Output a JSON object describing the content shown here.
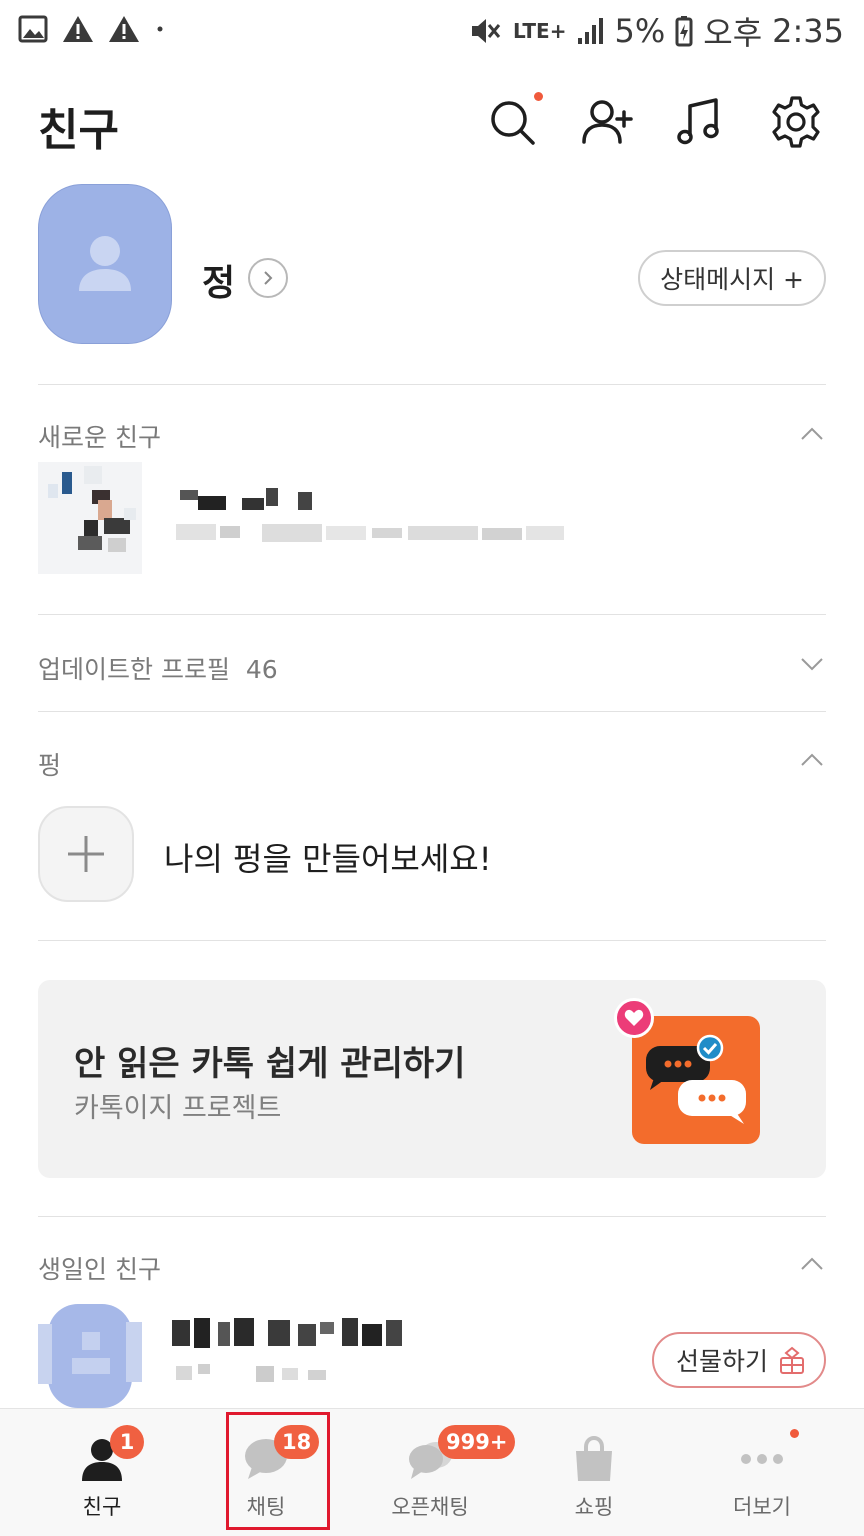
{
  "status_bar": {
    "battery": "5%",
    "network": "LTE+",
    "time_period": "오후",
    "time": "2:35"
  },
  "header": {
    "title": "친구",
    "icons": [
      "search-icon",
      "add-friend-icon",
      "music-icon",
      "gear-icon"
    ]
  },
  "profile": {
    "name": "정",
    "status_button_label": "상태메시지 +"
  },
  "sections": {
    "new_friends": {
      "title": "새로운 친구"
    },
    "updated_profiles": {
      "title": "업데이트한 프로필",
      "count": "46"
    },
    "pung": {
      "title": "펑",
      "create_prompt": "나의 펑을 만들어보세요!"
    },
    "birthday": {
      "title": "생일인 친구",
      "gift_button_label": "선물하기"
    }
  },
  "banner": {
    "title": "안 읽은 카톡 쉽게 관리하기",
    "subtitle": "카톡이지 프로젝트"
  },
  "bottom_nav": {
    "items": [
      {
        "label": "친구",
        "icon": "person-icon",
        "badge": "1",
        "active": true
      },
      {
        "label": "채팅",
        "icon": "chat-bubble-icon",
        "badge": "18",
        "active": false
      },
      {
        "label": "오픈채팅",
        "icon": "open-chat-icon",
        "badge": "999+",
        "active": false
      },
      {
        "label": "쇼핑",
        "icon": "shopping-bag-icon",
        "badge": "",
        "active": false
      },
      {
        "label": "더보기",
        "icon": "more-dots-icon",
        "badge": "",
        "active": false
      }
    ]
  },
  "colors": {
    "accent": "#f06041",
    "avatar": "#9db2e6",
    "banner_icon_bg": "#f36c2c",
    "highlight_outline": "#e0192e"
  }
}
